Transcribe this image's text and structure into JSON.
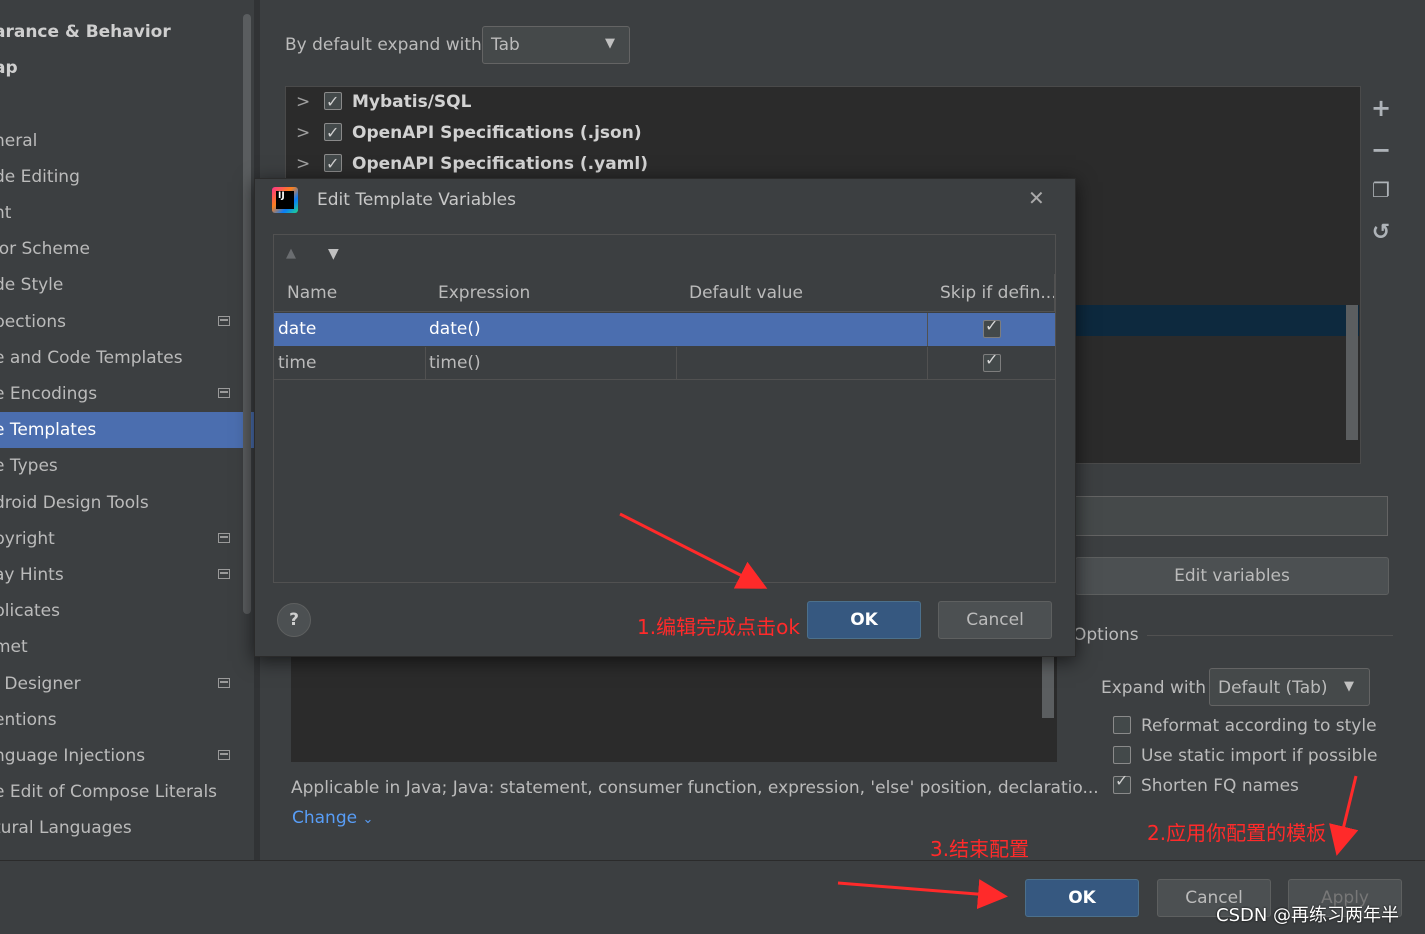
{
  "sidebar": {
    "items": [
      {
        "label": "arance & Behavior",
        "bold": true,
        "selected": false,
        "icon": false
      },
      {
        "label": "ap",
        "bold": true,
        "selected": false,
        "icon": false
      },
      {
        "label": "·",
        "bold": false,
        "selected": false,
        "icon": false
      },
      {
        "label": "neral",
        "bold": false,
        "selected": false,
        "icon": false
      },
      {
        "label": "de Editing",
        "bold": false,
        "selected": false,
        "icon": false
      },
      {
        "label": "nt",
        "bold": false,
        "selected": false,
        "icon": false
      },
      {
        "label": "lor Scheme",
        "bold": false,
        "selected": false,
        "icon": false
      },
      {
        "label": "de Style",
        "bold": false,
        "selected": false,
        "icon": false
      },
      {
        "label": "pections",
        "bold": false,
        "selected": false,
        "icon": true
      },
      {
        "label": "e and Code Templates",
        "bold": false,
        "selected": false,
        "icon": false
      },
      {
        "label": "e Encodings",
        "bold": false,
        "selected": false,
        "icon": true
      },
      {
        "label": "e Templates",
        "bold": false,
        "selected": true,
        "icon": false
      },
      {
        "label": "e Types",
        "bold": false,
        "selected": false,
        "icon": false
      },
      {
        "label": "droid Design Tools",
        "bold": false,
        "selected": false,
        "icon": false
      },
      {
        "label": "pyright",
        "bold": false,
        "selected": false,
        "icon": true
      },
      {
        "label": "ay Hints",
        "bold": false,
        "selected": false,
        "icon": true
      },
      {
        "label": "plicates",
        "bold": false,
        "selected": false,
        "icon": false
      },
      {
        "label": "met",
        "bold": false,
        "selected": false,
        "icon": false
      },
      {
        "label": "I Designer",
        "bold": false,
        "selected": false,
        "icon": true
      },
      {
        "label": "entions",
        "bold": false,
        "selected": false,
        "icon": false
      },
      {
        "label": "nguage Injections",
        "bold": false,
        "selected": false,
        "icon": true
      },
      {
        "label": "e Edit of Compose Literals",
        "bold": false,
        "selected": false,
        "icon": false
      },
      {
        "label": "tural Languages",
        "bold": false,
        "selected": false,
        "icon": false
      }
    ]
  },
  "main": {
    "expand_label": "By default expand with",
    "expand_value": "Tab",
    "groups": [
      {
        "label": "Mybatis/SQL",
        "checked": true
      },
      {
        "label": "OpenAPI Specifications (.json)",
        "checked": true
      },
      {
        "label": "OpenAPI Specifications (.yaml)",
        "checked": true
      }
    ],
    "edit_variables_label": "Edit variables",
    "options_label": "Options",
    "expand_with_label": "Expand with",
    "expand_with_value": "Default (Tab)",
    "opt_reformat": "Reformat according to style",
    "opt_static_import": "Use static import if possible",
    "opt_shorten": "Shorten FQ names",
    "applicable_text": "Applicable in Java; Java: statement, consumer function, expression, 'else' position, declaratio...",
    "change_label": "Change"
  },
  "dialog": {
    "title": "Edit Template Variables",
    "columns": [
      "Name",
      "Expression",
      "Default value",
      "Skip if defin..."
    ],
    "rows": [
      {
        "name": "date",
        "expression": "date()",
        "default": "",
        "skip": true
      },
      {
        "name": "time",
        "expression": "time()",
        "default": "",
        "skip": true
      }
    ],
    "ok_label": "OK",
    "cancel_label": "Cancel",
    "help_label": "?"
  },
  "footer": {
    "ok_label": "OK",
    "cancel_label": "Cancel",
    "apply_label": "Apply"
  },
  "annotations": {
    "a1": "1.编辑完成点击ok",
    "a2": "2.应用你配置的模板",
    "a3": "3.结束配置"
  },
  "watermark": "CSDN @再练习两年半",
  "colors": {
    "accent_selection": "#4b6eaf",
    "annotation_red": "#ff2a2a",
    "primary_button": "#365880"
  }
}
